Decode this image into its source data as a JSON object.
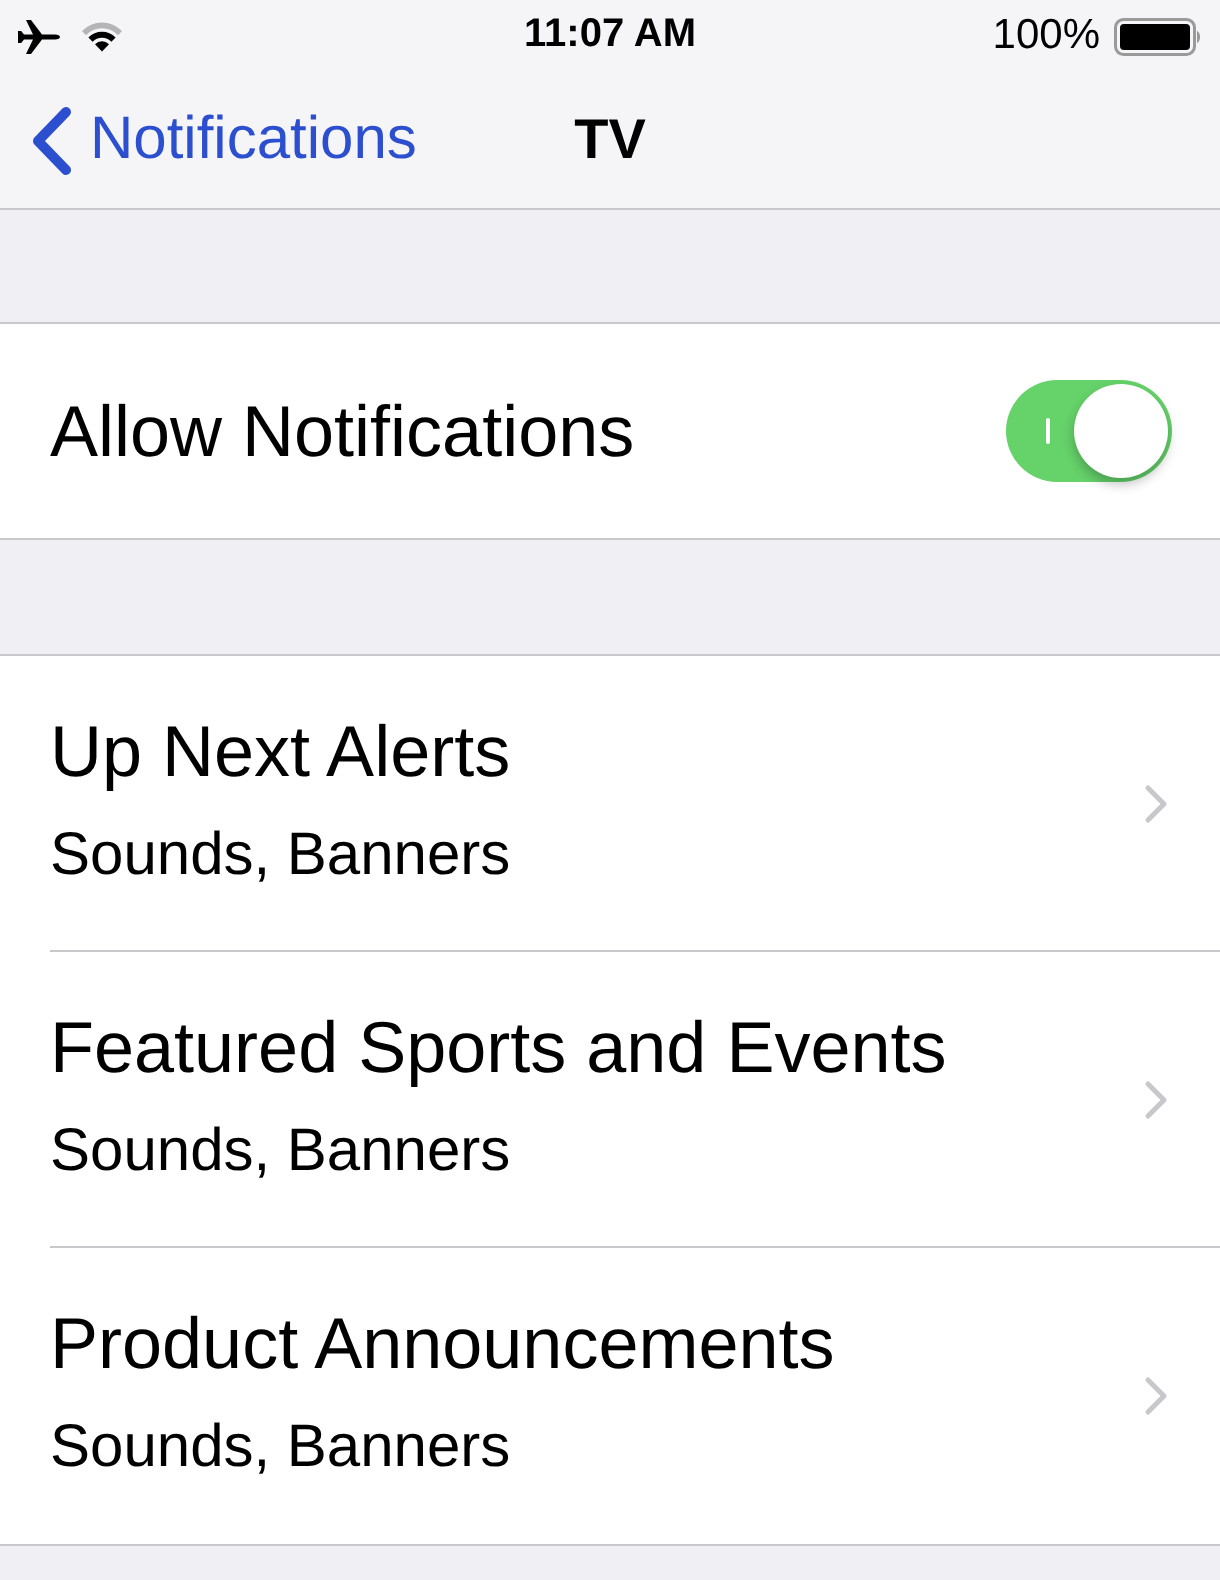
{
  "status_bar": {
    "time": "11:07 AM",
    "battery": "100%"
  },
  "nav_bar": {
    "back": "Notifications",
    "title": "TV"
  },
  "allow_notifications": {
    "label": "Allow Notifications",
    "on": true
  },
  "categories": [
    {
      "title": "Up Next Alerts",
      "subtitle": "Sounds, Banners"
    },
    {
      "title": "Featured Sports and Events",
      "subtitle": "Sounds, Banners"
    },
    {
      "title": "Product Announcements",
      "subtitle": "Sounds, Banners"
    }
  ]
}
